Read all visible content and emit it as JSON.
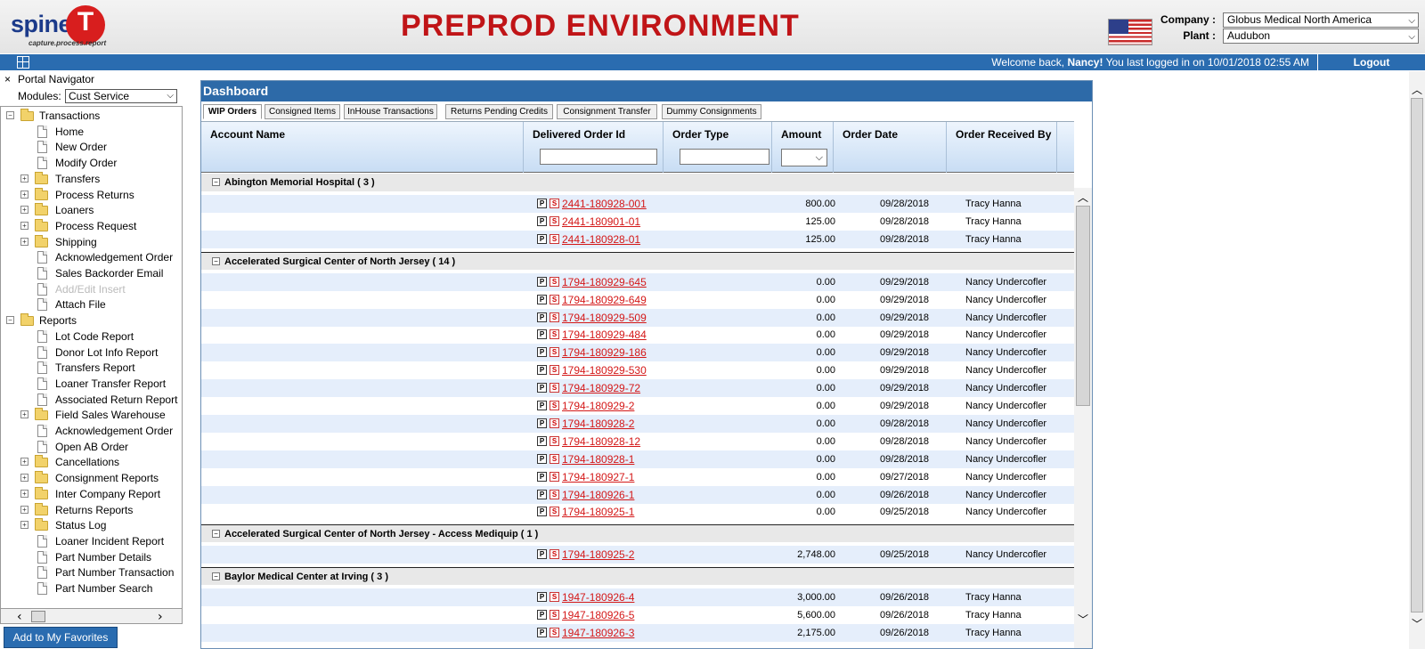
{
  "header": {
    "logo_word": "spine",
    "logo_t": "T",
    "logo_tagline": "capture.process.report",
    "environment_title": "PREPROD ENVIRONMENT",
    "company_label": "Company :",
    "company_value": "Globus Medical North America",
    "plant_label": "Plant :",
    "plant_value": "Audubon"
  },
  "topbar": {
    "welcome_prefix": "Welcome back, ",
    "user_name": "Nancy!",
    "welcome_suffix": " You last logged in on 10/01/2018 02:55 AM",
    "logout_label": "Logout"
  },
  "navigator": {
    "close_glyph": "×",
    "title": "Portal Navigator",
    "modules_label": "Modules:",
    "modules_value": "Cust Service",
    "favorites_label": "Add to My Favorites",
    "tree": [
      {
        "label": "Transactions",
        "level": 0,
        "kind": "folder",
        "expander": "−"
      },
      {
        "label": "Home",
        "level": 1,
        "kind": "doc"
      },
      {
        "label": "New Order",
        "level": 1,
        "kind": "doc"
      },
      {
        "label": "Modify Order",
        "level": 1,
        "kind": "doc"
      },
      {
        "label": "Transfers",
        "level": 1,
        "kind": "folder",
        "expander": "+"
      },
      {
        "label": "Process Returns",
        "level": 1,
        "kind": "folder",
        "expander": "+"
      },
      {
        "label": "Loaners",
        "level": 1,
        "kind": "folder",
        "expander": "+"
      },
      {
        "label": "Process Request",
        "level": 1,
        "kind": "folder",
        "expander": "+"
      },
      {
        "label": "Shipping",
        "level": 1,
        "kind": "folder",
        "expander": "+"
      },
      {
        "label": "Acknowledgement Order",
        "level": 1,
        "kind": "doc"
      },
      {
        "label": "Sales Backorder Email",
        "level": 1,
        "kind": "doc"
      },
      {
        "label": "Add/Edit Insert",
        "level": 1,
        "kind": "doc",
        "disabled": true
      },
      {
        "label": "Attach File",
        "level": 1,
        "kind": "doc"
      },
      {
        "label": "Reports",
        "level": 0,
        "kind": "folder",
        "expander": "−"
      },
      {
        "label": "Lot Code Report",
        "level": 1,
        "kind": "doc"
      },
      {
        "label": "Donor Lot Info Report",
        "level": 1,
        "kind": "doc"
      },
      {
        "label": "Transfers Report",
        "level": 1,
        "kind": "doc"
      },
      {
        "label": "Loaner Transfer Report",
        "level": 1,
        "kind": "doc"
      },
      {
        "label": "Associated Return Report",
        "level": 1,
        "kind": "doc"
      },
      {
        "label": "Field Sales Warehouse",
        "level": 1,
        "kind": "folder",
        "expander": "+"
      },
      {
        "label": "Acknowledgement Order",
        "level": 1,
        "kind": "doc"
      },
      {
        "label": "Open AB Order",
        "level": 1,
        "kind": "doc"
      },
      {
        "label": "Cancellations",
        "level": 1,
        "kind": "folder",
        "expander": "+"
      },
      {
        "label": "Consignment Reports",
        "level": 1,
        "kind": "folder",
        "expander": "+"
      },
      {
        "label": "Inter Company Report",
        "level": 1,
        "kind": "folder",
        "expander": "+"
      },
      {
        "label": "Returns Reports",
        "level": 1,
        "kind": "folder",
        "expander": "+"
      },
      {
        "label": "Status Log",
        "level": 1,
        "kind": "folder",
        "expander": "+"
      },
      {
        "label": "Loaner Incident Report",
        "level": 1,
        "kind": "doc"
      },
      {
        "label": "Part Number Details",
        "level": 1,
        "kind": "doc"
      },
      {
        "label": "Part Number Transaction",
        "level": 1,
        "kind": "doc"
      },
      {
        "label": "Part Number Search",
        "level": 1,
        "kind": "doc"
      }
    ]
  },
  "dashboard": {
    "title": "Dashboard",
    "tabs": [
      {
        "label": "WIP Orders",
        "active": true
      },
      {
        "label": "Consigned Items"
      },
      {
        "label": "InHouse Transactions"
      },
      {
        "label": "Returns Pending Credits"
      },
      {
        "label": "Consignment Transfer"
      },
      {
        "label": "Dummy Consignments"
      }
    ],
    "columns": {
      "account_name": "Account Name",
      "delivered_order_id": "Delivered Order Id",
      "order_type": "Order Type",
      "amount": "Amount",
      "order_date": "Order Date",
      "order_received_by": "Order Received By"
    },
    "badge_p": "P",
    "badge_s": "S",
    "groups": [
      {
        "label": "Abington Memorial Hospital ( 3 )",
        "rows": [
          {
            "order_id": "2441-180928-001",
            "amount": "800.00",
            "date": "09/28/2018",
            "received_by": "Tracy Hanna"
          },
          {
            "order_id": "2441-180901-01",
            "amount": "125.00",
            "date": "09/28/2018",
            "received_by": "Tracy Hanna"
          },
          {
            "order_id": "2441-180928-01",
            "amount": "125.00",
            "date": "09/28/2018",
            "received_by": "Tracy Hanna"
          }
        ]
      },
      {
        "label": "Accelerated Surgical Center of North Jersey ( 14 )",
        "rows": [
          {
            "order_id": "1794-180929-645",
            "amount": "0.00",
            "date": "09/29/2018",
            "received_by": "Nancy Undercofler"
          },
          {
            "order_id": "1794-180929-649",
            "amount": "0.00",
            "date": "09/29/2018",
            "received_by": "Nancy Undercofler"
          },
          {
            "order_id": "1794-180929-509",
            "amount": "0.00",
            "date": "09/29/2018",
            "received_by": "Nancy Undercofler"
          },
          {
            "order_id": "1794-180929-484",
            "amount": "0.00",
            "date": "09/29/2018",
            "received_by": "Nancy Undercofler"
          },
          {
            "order_id": "1794-180929-186",
            "amount": "0.00",
            "date": "09/29/2018",
            "received_by": "Nancy Undercofler"
          },
          {
            "order_id": "1794-180929-530",
            "amount": "0.00",
            "date": "09/29/2018",
            "received_by": "Nancy Undercofler"
          },
          {
            "order_id": "1794-180929-72",
            "amount": "0.00",
            "date": "09/29/2018",
            "received_by": "Nancy Undercofler"
          },
          {
            "order_id": "1794-180929-2",
            "amount": "0.00",
            "date": "09/29/2018",
            "received_by": "Nancy Undercofler"
          },
          {
            "order_id": "1794-180928-2",
            "amount": "0.00",
            "date": "09/28/2018",
            "received_by": "Nancy Undercofler"
          },
          {
            "order_id": "1794-180928-12",
            "amount": "0.00",
            "date": "09/28/2018",
            "received_by": "Nancy Undercofler"
          },
          {
            "order_id": "1794-180928-1",
            "amount": "0.00",
            "date": "09/28/2018",
            "received_by": "Nancy Undercofler"
          },
          {
            "order_id": "1794-180927-1",
            "amount": "0.00",
            "date": "09/27/2018",
            "received_by": "Nancy Undercofler"
          },
          {
            "order_id": "1794-180926-1",
            "amount": "0.00",
            "date": "09/26/2018",
            "received_by": "Nancy Undercofler"
          },
          {
            "order_id": "1794-180925-1",
            "amount": "0.00",
            "date": "09/25/2018",
            "received_by": "Nancy Undercofler"
          }
        ]
      },
      {
        "label": "Accelerated Surgical Center of North Jersey - Access Mediquip ( 1 )",
        "rows": [
          {
            "order_id": "1794-180925-2",
            "amount": "2,748.00",
            "date": "09/25/2018",
            "received_by": "Nancy Undercofler"
          }
        ]
      },
      {
        "label": "Baylor Medical Center at Irving ( 3 )",
        "rows": [
          {
            "order_id": "1947-180926-4",
            "amount": "3,000.00",
            "date": "09/26/2018",
            "received_by": "Tracy Hanna"
          },
          {
            "order_id": "1947-180926-5",
            "amount": "5,600.00",
            "date": "09/26/2018",
            "received_by": "Tracy Hanna"
          },
          {
            "order_id": "1947-180926-3",
            "amount": "2,175.00",
            "date": "09/26/2018",
            "received_by": "Tracy Hanna"
          }
        ]
      }
    ]
  },
  "icons": {
    "dropdown": "chevron-down-icon",
    "expand": "plus-box-icon",
    "collapse": "minus-box-icon",
    "folder": "folder-icon",
    "document": "document-icon"
  },
  "colors": {
    "brand_blue": "#2a6cb0",
    "env_red": "#c01417",
    "link_red": "#d41818"
  }
}
